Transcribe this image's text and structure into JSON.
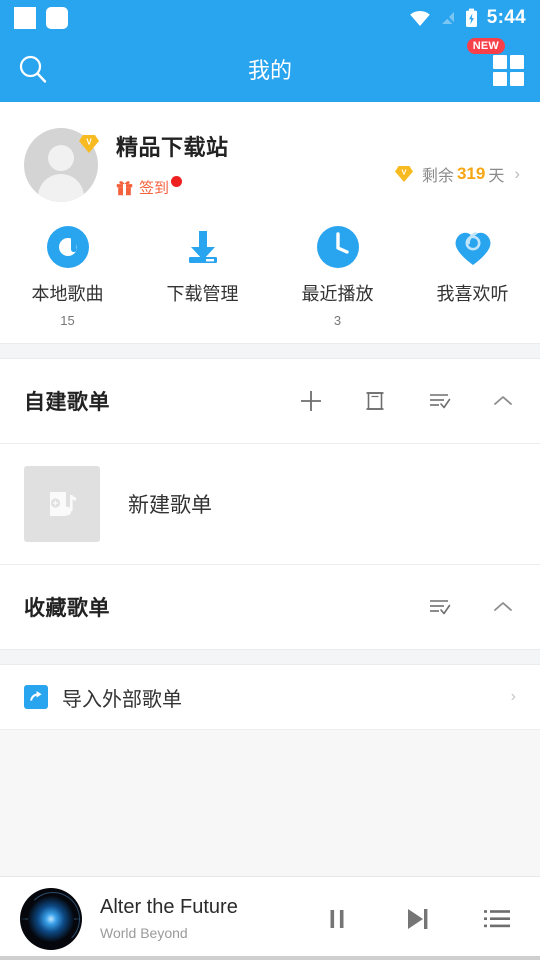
{
  "status_bar": {
    "time": "5:44",
    "icons": [
      "notification-square-icon",
      "notification-rounded-icon",
      "wifi-icon",
      "signal-off-icon",
      "battery-charging-icon"
    ]
  },
  "app_bar": {
    "title": "我的",
    "search_icon": "search-icon",
    "grid_icon": "grid-icon",
    "new_badge": "NEW"
  },
  "profile": {
    "username": "精品下载站",
    "vip_avatar_badge": "V",
    "signin_label": "签到",
    "signin_has_dot": true,
    "vip_prefix": "剩余",
    "vip_days": "319",
    "vip_suffix": "天",
    "chevron": "›"
  },
  "quick_actions": [
    {
      "label": "本地歌曲",
      "count": "15",
      "icon": "local-music-icon"
    },
    {
      "label": "下载管理",
      "count": "",
      "icon": "download-icon"
    },
    {
      "label": "最近播放",
      "count": "3",
      "icon": "recent-clock-icon"
    },
    {
      "label": "我喜欢听",
      "count": "",
      "icon": "heart-icon"
    }
  ],
  "created_section": {
    "title": "自建歌单",
    "actions": [
      "add-icon",
      "archive-icon",
      "sort-icon",
      "collapse-icon"
    ]
  },
  "new_playlist_row": {
    "label": "新建歌单",
    "thumb_icon": "add-playlist-icon"
  },
  "favorite_section": {
    "title": "收藏歌单",
    "actions": [
      "sort-icon",
      "collapse-icon"
    ]
  },
  "import_row": {
    "label": "导入外部歌单",
    "icon": "import-arrow-icon",
    "chevron": "›"
  },
  "player": {
    "title": "Alter the Future",
    "artist": "World Beyond",
    "pause_icon": "pause-icon",
    "next_icon": "next-track-icon",
    "queue_icon": "playlist-queue-icon",
    "progress_percent": 51
  },
  "colors": {
    "accent": "#29a4ef",
    "badge_red": "#f8404a",
    "vip_gold": "#f7a613",
    "signin_orange": "#f4613c"
  }
}
